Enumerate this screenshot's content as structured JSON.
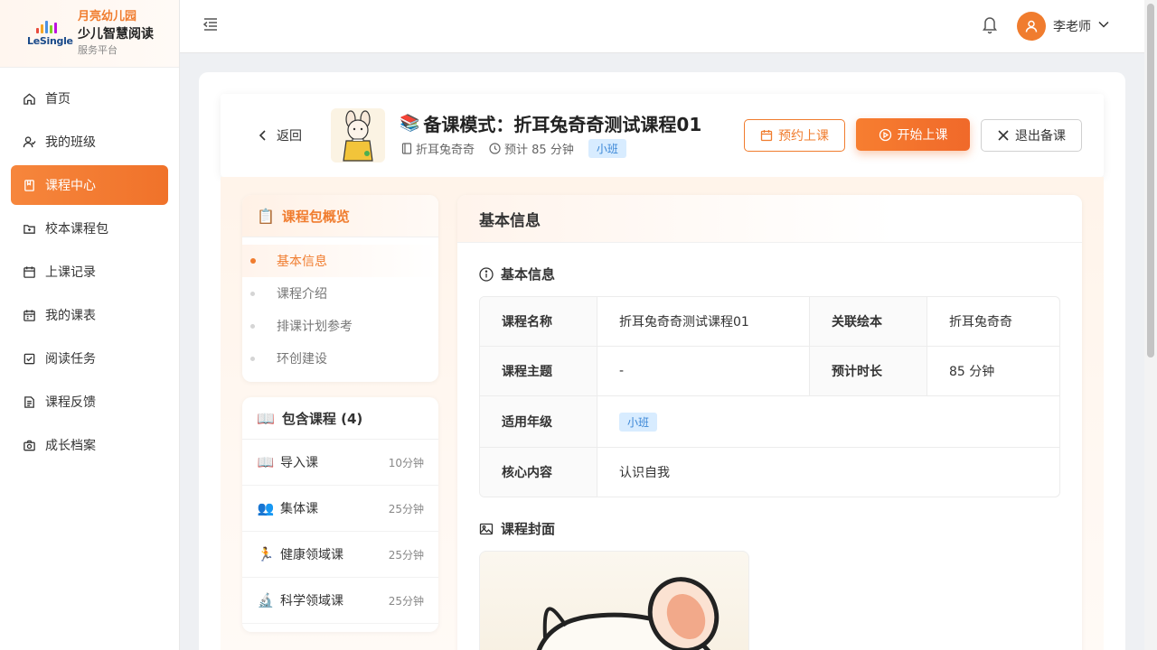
{
  "brand": {
    "org": "月亮幼儿园",
    "name": "少儿智慧阅读",
    "sub": "服务平台",
    "logo_text": "LeSingle"
  },
  "nav": [
    {
      "label": "首页",
      "icon": "home-icon"
    },
    {
      "label": "我的班级",
      "icon": "user-group-icon"
    },
    {
      "label": "课程中心",
      "icon": "book-icon",
      "active": true
    },
    {
      "label": "校本课程包",
      "icon": "folder-icon"
    },
    {
      "label": "上课记录",
      "icon": "calendar-icon"
    },
    {
      "label": "我的课表",
      "icon": "schedule-icon"
    },
    {
      "label": "阅读任务",
      "icon": "task-check-icon"
    },
    {
      "label": "课程反馈",
      "icon": "feedback-icon"
    },
    {
      "label": "成长档案",
      "icon": "camera-icon"
    }
  ],
  "header": {
    "username": "李老师"
  },
  "topbar": {
    "back_label": "返回",
    "title": "备课模式：折耳兔奇奇测试课程01",
    "book": "折耳兔奇奇",
    "duration": "预计 85 分钟",
    "grade_tag": "小班",
    "book_button": "预约上课",
    "start_button": "开始上课",
    "exit_button": "退出备课"
  },
  "overview": {
    "title": "课程包概览",
    "items": [
      "基本信息",
      "课程介绍",
      "排课计划参考",
      "环创建设"
    ]
  },
  "courses": {
    "title": "包含课程 (4)",
    "items": [
      {
        "icon": "📖",
        "name": "导入课",
        "duration": "10分钟"
      },
      {
        "icon": "👥",
        "name": "集体课",
        "duration": "25分钟"
      },
      {
        "icon": "🏃",
        "name": "健康领域课",
        "duration": "25分钟"
      },
      {
        "icon": "🔬",
        "name": "科学领域课",
        "duration": "25分钟"
      }
    ]
  },
  "detail": {
    "header": "基本信息",
    "section_info": "基本信息",
    "section_cover": "课程封面",
    "rows": {
      "name_label": "课程名称",
      "name_value": "折耳兔奇奇测试课程01",
      "book_label": "关联绘本",
      "book_value": "折耳兔奇奇",
      "theme_label": "课程主题",
      "theme_value": "-",
      "time_label": "预计时长",
      "time_value": "85 分钟",
      "grade_label": "适用年级",
      "grade_value": "小班",
      "core_label": "核心内容",
      "core_value": "认识自我"
    }
  },
  "colors": {
    "accent": "#f07c2e",
    "tag_bg": "#d8ecff",
    "tag_text": "#3a86d6"
  }
}
